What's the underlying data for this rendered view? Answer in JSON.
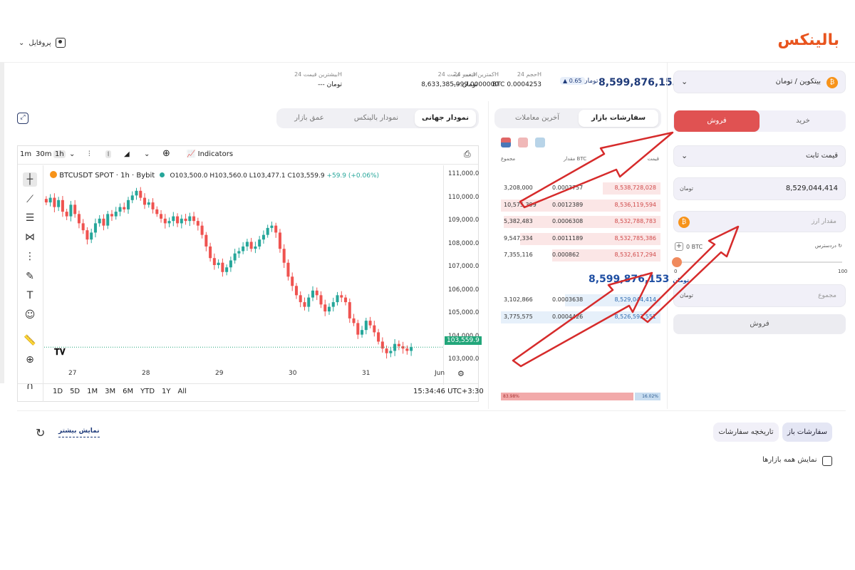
{
  "header": {
    "logo": "بالینکس",
    "profile_label": "پروفایل"
  },
  "market": {
    "pair": "بیتکوین / تومان",
    "price": "8,599,876,153",
    "price_unit": "تومان",
    "change": "0.65",
    "stats": [
      {
        "label": "حجم 24H",
        "value": "BTC 0.0004253"
      },
      {
        "label": "تغییر قیمت 24H",
        "value": "--- تومان"
      },
      {
        "label": "کمترین قیمت 24H",
        "value": "8,633,385,999.0000000"
      },
      {
        "label": "بیشترین قیمت 24H",
        "value": "--- تومان"
      }
    ]
  },
  "chart_tabs": [
    "نمودار جهانی",
    "نمودار بالینکس",
    "عمق بازار"
  ],
  "book_tabs": [
    "سفارشات بازار",
    "آخرین معاملات"
  ],
  "orderbook": {
    "headers": {
      "price": "قیمت",
      "amount": "مقدار BTC",
      "total": "مجموع"
    },
    "sells": [
      {
        "total": "3,208,000",
        "amount": "0.0003757",
        "price": "8,538,728,028",
        "depth": 0.36
      },
      {
        "total": "10,575,399",
        "amount": "0.0012389",
        "price": "8,536,119,594",
        "depth": 1.0
      },
      {
        "total": "5,382,483",
        "amount": "0.0006308",
        "price": "8,532,788,783",
        "depth": 0.98
      },
      {
        "total": "9,547,334",
        "amount": "0.0011189",
        "price": "8,532,785,386",
        "depth": 0.88
      },
      {
        "total": "7,355,116",
        "amount": "0.000862",
        "price": "8,532,617,294",
        "depth": 0.68
      }
    ],
    "mid_price": "8,599,876,153",
    "mid_unit": "تومان",
    "buys": [
      {
        "total": "3,102,866",
        "amount": "0.0003638",
        "price": "8,529,044,414",
        "depth": 0.6
      },
      {
        "total": "3,775,575",
        "amount": "0.0004426",
        "price": "8,526,592,551",
        "depth": 1.0
      }
    ],
    "sell_pct": "83.98%",
    "buy_pct": "16.02%"
  },
  "tv": {
    "timeframes": [
      "1m",
      "30m",
      "1h"
    ],
    "indicators": "Indicators",
    "symbol": "BTCUSDT SPOT · 1h · Bybit",
    "ohlc": {
      "o": "O103,500.0",
      "h": "H103,560.0",
      "l": "L103,477.1",
      "c": "C103,559.9",
      "chg": "+59.9 (+0.06%)"
    },
    "price_tag": "103,559.9",
    "ranges": [
      "1D",
      "5D",
      "1M",
      "3M",
      "6M",
      "YTD",
      "1Y",
      "All"
    ],
    "time": "15:34:46 UTC+3:30"
  },
  "chart_data": {
    "type": "candlestick",
    "y_ticks": [
      "111,000.0",
      "110,000.0",
      "109,000.0",
      "108,000.0",
      "107,000.0",
      "106,000.0",
      "105,000.0",
      "104,000.0",
      "103,000.0"
    ],
    "ylim": [
      102800,
      111400
    ],
    "x_ticks": [
      "27",
      "28",
      "29",
      "30",
      "31",
      "Jun"
    ],
    "closes": [
      109800,
      110000,
      109600,
      109900,
      109400,
      109200,
      109700,
      109300,
      108900,
      108600,
      108200,
      108500,
      108900,
      109100,
      108800,
      109300,
      109200,
      109400,
      109600,
      109500,
      109900,
      110100,
      110300,
      110000,
      109700,
      109800,
      109500,
      109300,
      109100,
      108900,
      109000,
      109200,
      108900,
      109100,
      109000,
      109200,
      109000,
      108800,
      108400,
      107900,
      107400,
      107100,
      107200,
      106800,
      107000,
      107300,
      107600,
      107700,
      107900,
      108100,
      107800,
      107900,
      108200,
      108400,
      108700,
      108800,
      108500,
      107800,
      107200,
      106600,
      106200,
      105800,
      105500,
      105300,
      105700,
      106000,
      105800,
      105400,
      105100,
      105300,
      105500,
      105800,
      105700,
      105500,
      104800,
      104600,
      104100,
      104300,
      104700,
      104500,
      104200,
      103800,
      103500,
      103300,
      103400,
      103700,
      103600,
      103500,
      103400,
      103560
    ],
    "last": 103559.9
  },
  "trade": {
    "buy_tab": "خرید",
    "sell_tab": "فروش",
    "order_type": "قیمت ثابت",
    "price_value": "8,529,044,414",
    "amount_placeholder": "مقدار ارز",
    "available_label": "دردسترس",
    "available_value": "0 BTC",
    "slider_min": "0",
    "slider_max": "100",
    "slider_value": 0,
    "total_placeholder": "مجموع",
    "submit": "فروش"
  },
  "bottom": {
    "tabs": [
      "سفارشات باز",
      "تاریخچه سفارشات"
    ],
    "show_more": "نمایش بیشتر",
    "show_all": "نمایش همه بازارها"
  }
}
